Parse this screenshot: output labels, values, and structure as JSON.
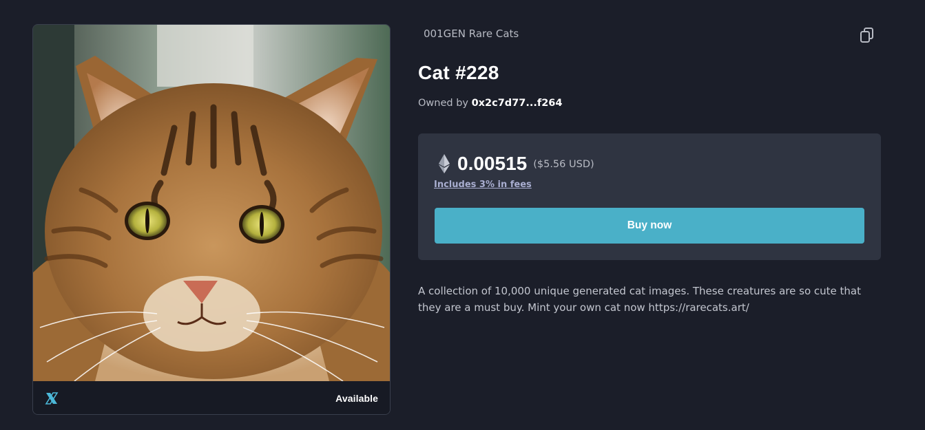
{
  "collection": {
    "name": "001GEN Rare Cats"
  },
  "item": {
    "title": "Cat #228",
    "owned_by_label": "Owned by",
    "owner_address": "0x2c7d77...f264",
    "status": "Available"
  },
  "price": {
    "amount": "0.00515",
    "usd": "($5.56 USD)",
    "fees_note": "Includes 3% in fees",
    "currency_icon": "eth-icon"
  },
  "actions": {
    "buy_label": "Buy now",
    "copy_icon": "copy-icon"
  },
  "description": "A collection of 10,000 unique generated cat images. These creatures are so cute that they are a must buy. Mint your own cat now https://rarecats.art/",
  "colors": {
    "background": "#1b1e29",
    "panel": "#2f3441",
    "accent": "#4ab0c8",
    "chain_icon": "#4cb8d8"
  }
}
